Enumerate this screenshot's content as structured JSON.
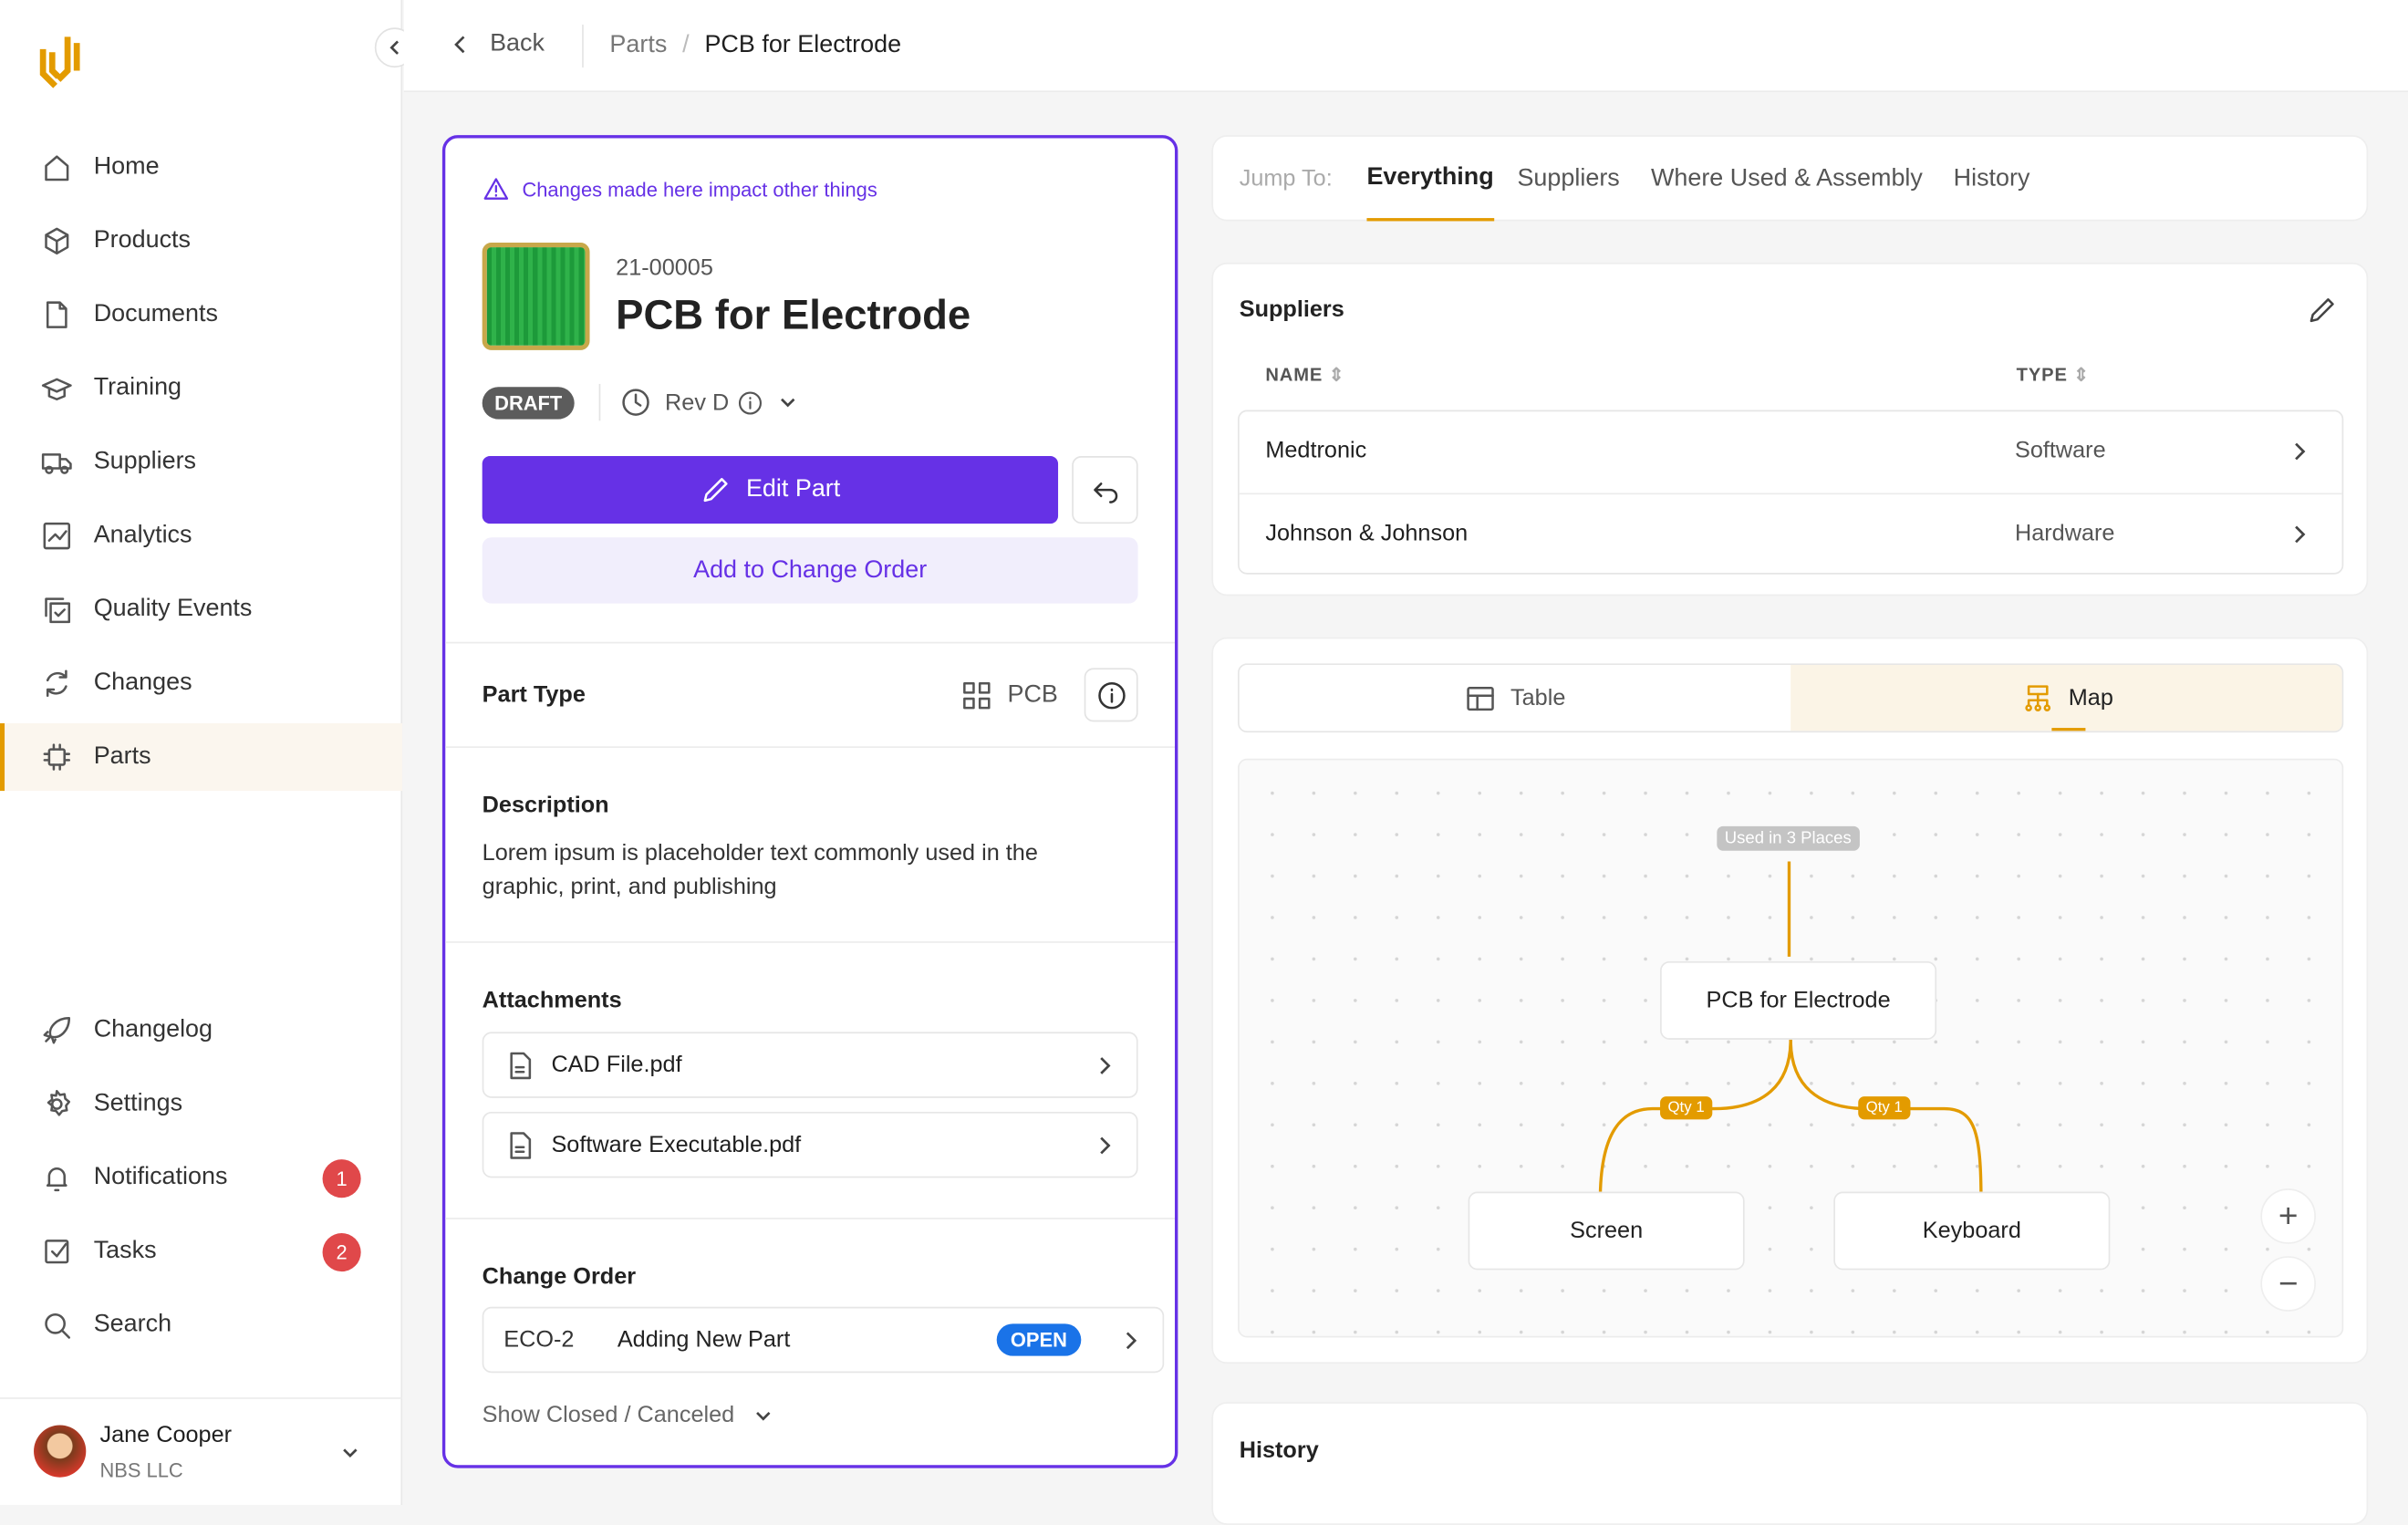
{
  "sidebar": {
    "items": [
      {
        "label": "Home",
        "icon": "home-icon"
      },
      {
        "label": "Products",
        "icon": "box-icon"
      },
      {
        "label": "Documents",
        "icon": "document-icon"
      },
      {
        "label": "Training",
        "icon": "graduation-cap-icon"
      },
      {
        "label": "Suppliers",
        "icon": "truck-icon"
      },
      {
        "label": "Analytics",
        "icon": "chart-icon"
      },
      {
        "label": "Quality Events",
        "icon": "copy-check-icon"
      },
      {
        "label": "Changes",
        "icon": "refresh-icon"
      },
      {
        "label": "Parts",
        "icon": "chip-icon"
      }
    ],
    "bottom": [
      {
        "label": "Changelog",
        "icon": "rocket-icon"
      },
      {
        "label": "Settings",
        "icon": "gear-icon"
      },
      {
        "label": "Notifications",
        "icon": "bell-icon",
        "badge": "1"
      },
      {
        "label": "Tasks",
        "icon": "checkbox-icon",
        "badge": "2"
      },
      {
        "label": "Search",
        "icon": "search-icon"
      }
    ],
    "user": {
      "name": "Jane Cooper",
      "org": "NBS LLC"
    }
  },
  "topbar": {
    "back": "Back",
    "breadcrumb": [
      "Parts",
      "PCB for Electrode"
    ]
  },
  "part": {
    "warning": "Changes made here impact other things",
    "number": "21-00005",
    "title": "PCB for Electrode",
    "status": "DRAFT",
    "revision": "Rev D",
    "edit": "Edit Part",
    "add_change_order": "Add to Change Order",
    "part_type_label": "Part Type",
    "part_type": "PCB",
    "description_label": "Description",
    "description": "Lorem ipsum is placeholder text commonly used in the graphic, print, and publishing",
    "attachments_label": "Attachments",
    "attachments": [
      "CAD File.pdf",
      "Software Executable.pdf"
    ],
    "change_order_label": "Change Order",
    "change_order": {
      "id": "ECO-2",
      "title": "Adding New Part",
      "status": "OPEN"
    },
    "show_closed": "Show Closed / Canceled"
  },
  "jump": {
    "label": "Jump To:",
    "tabs": [
      "Everything",
      "Suppliers",
      "Where Used & Assembly",
      "History"
    ],
    "active": "Everything"
  },
  "suppliers": {
    "title": "Suppliers",
    "columns": [
      "NAME",
      "TYPE"
    ],
    "rows": [
      {
        "name": "Medtronic",
        "type": "Software"
      },
      {
        "name": "Johnson & Johnson",
        "type": "Hardware"
      }
    ]
  },
  "whereused": {
    "toggle": [
      "Table",
      "Map"
    ],
    "active": "Map",
    "used_in": "Used in 3 Places",
    "root": "PCB for Electrode",
    "children": [
      {
        "name": "Screen",
        "qty": "Qty 1"
      },
      {
        "name": "Keyboard",
        "qty": "Qty 1"
      }
    ]
  },
  "history": {
    "title": "History"
  },
  "colors": {
    "accent": "#6631e6",
    "brand": "#e39b00",
    "open": "#1a73e8",
    "danger": "#e0484a"
  }
}
